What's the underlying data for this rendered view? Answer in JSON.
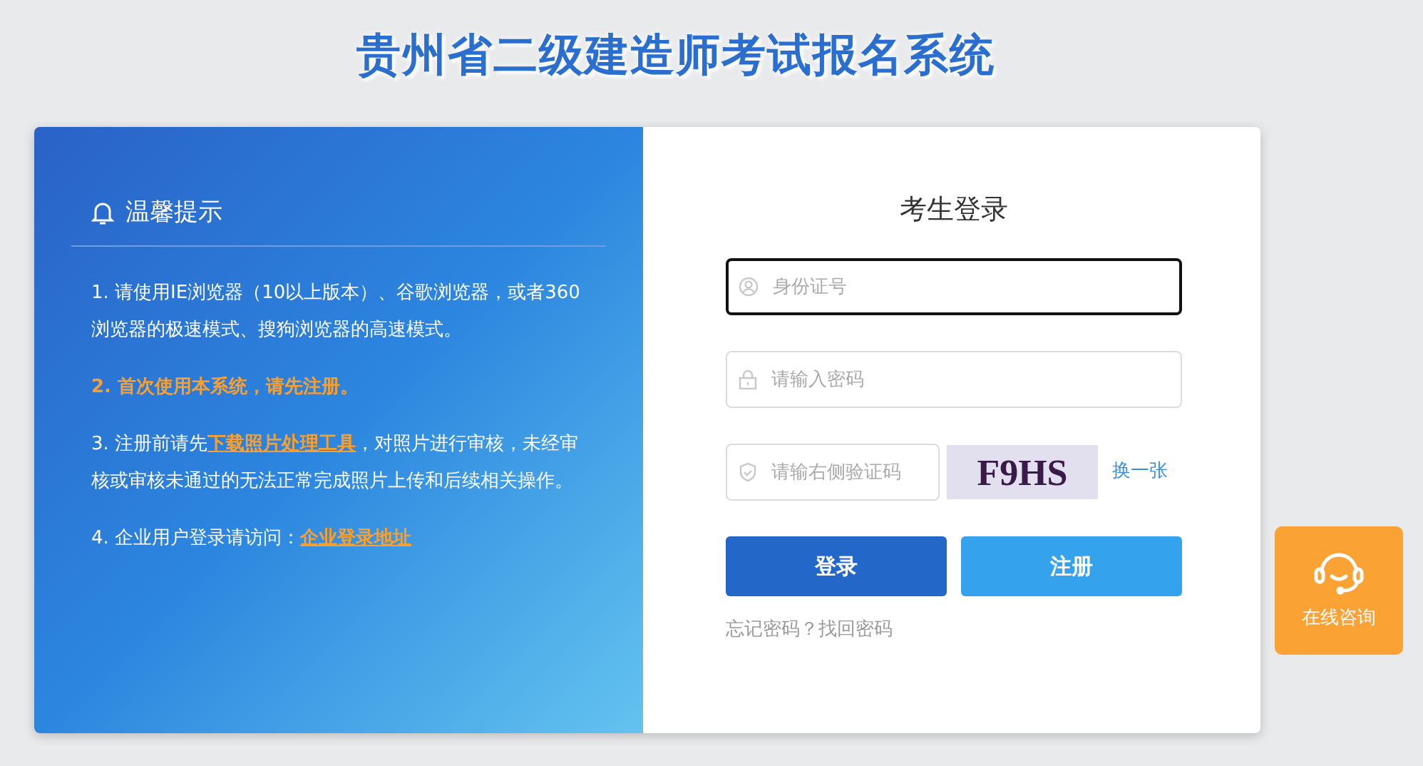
{
  "page_title": "贵州省二级建造师考试报名系统",
  "notice": {
    "title": "温馨提示",
    "items": [
      {
        "kind": "plain",
        "parts": [
          {
            "kind": "text",
            "text": "1. 请使用IE浏览器（10以上版本）、谷歌浏览器，或者360浏览器的极速模式、搜狗浏览器的高速模式。"
          }
        ]
      },
      {
        "kind": "highlight",
        "parts": [
          {
            "kind": "text",
            "text": "2. 首次使用本系统，请先注册。"
          }
        ]
      },
      {
        "kind": "plain",
        "parts": [
          {
            "kind": "text",
            "text": "3. 注册前请先"
          },
          {
            "kind": "link",
            "text": "下载照片处理工具"
          },
          {
            "kind": "text",
            "text": "，对照片进行审核，未经审核或审核未通过的无法正常完成照片上传和后续相关操作。"
          }
        ]
      },
      {
        "kind": "plain",
        "parts": [
          {
            "kind": "text",
            "text": "4. 企业用户登录请访问："
          },
          {
            "kind": "link",
            "text": "企业登录地址"
          }
        ]
      }
    ]
  },
  "login": {
    "title": "考生登录",
    "fields": [
      {
        "kind": "user",
        "placeholder": "身份证号",
        "focused": true
      },
      {
        "kind": "lock",
        "placeholder": "请输入密码",
        "focused": false
      }
    ],
    "captcha": {
      "placeholder": "请输右侧验证码",
      "image_text": "F9HS",
      "refresh": "换一张"
    },
    "buttons": [
      {
        "kind": "primary",
        "label": "登录"
      },
      {
        "kind": "secondary",
        "label": "注册"
      }
    ],
    "forgot_text": "忘记密码？",
    "forgot_link": "找回密码"
  },
  "consult": {
    "label": "在线咨询"
  }
}
